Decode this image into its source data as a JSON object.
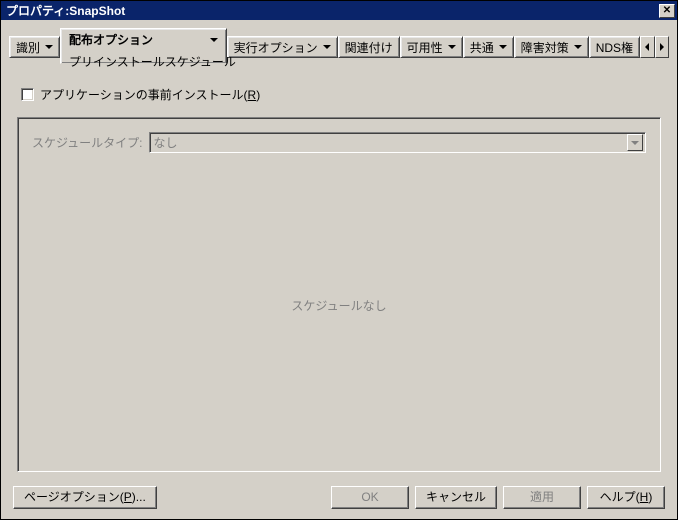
{
  "window": {
    "title": "プロパティ:SnapShot",
    "close_glyph": "✕"
  },
  "tabs": {
    "identify": "識別",
    "dist_options": "配布オプション",
    "dist_sub": "プリインストールスケジュール",
    "run_options": "実行オプション",
    "association": "関連付け",
    "availability": "可用性",
    "common": "共通",
    "fault": "障害対策",
    "nds": "NDS権"
  },
  "content": {
    "pre_install_label": "アプリケーションの事前インストール",
    "pre_install_mnemonic": "R",
    "schedule_type_label": "スケジュールタイプ:",
    "schedule_type_value": "なし",
    "no_schedule": "スケジュールなし"
  },
  "buttons": {
    "page_options": "ページオプション",
    "page_options_mnemonic": "P",
    "ok": "OK",
    "cancel": "キャンセル",
    "apply": "適用",
    "help": "ヘルプ",
    "help_mnemonic": "H"
  }
}
